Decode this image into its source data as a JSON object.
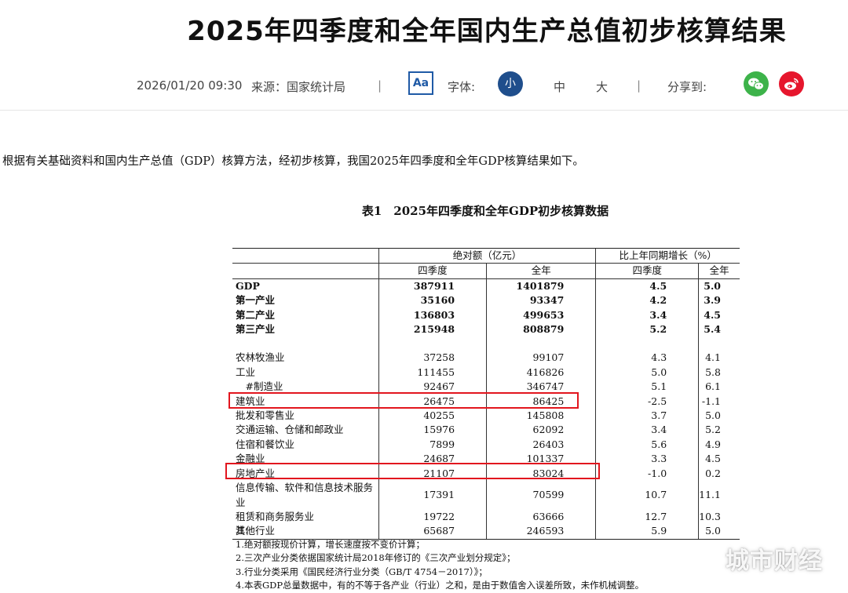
{
  "article": {
    "title": "2025年四季度和全年国内生产总值初步核算结果",
    "datetime": "2026/01/20 09:30",
    "source": "来源：国家统计局",
    "separator": "|",
    "font_button": "Aa",
    "font_label": "字体:",
    "size_small": "小",
    "size_medium": "中",
    "size_large": "大",
    "share_label": "分享到:",
    "intro": "根据有关基础资料和国内生产总值（GDP）核算方法，经初步核算，我国2025年四季度和全年GDP核算结果如下。"
  },
  "share_icons": [
    {
      "name": "wechat-icon",
      "color": "#3db34a"
    },
    {
      "name": "weibo-icon",
      "color": "#e6162d"
    }
  ],
  "table": {
    "title": "表1　2025年四季度和全年GDP初步核算数据",
    "group_absolute": "绝对额（亿元）",
    "group_growth": "比上年同期增长（%）",
    "sub_headers": [
      "四季度",
      "全年",
      "四季度",
      "全年"
    ],
    "rows": [
      {
        "name": "GDP",
        "q4": "387911",
        "year": "1401879",
        "g_q4": "4.5",
        "g_year": "5.0",
        "bold": true
      },
      {
        "name": "第一产业",
        "q4": "35160",
        "year": "93347",
        "g_q4": "4.2",
        "g_year": "3.9",
        "bold": true
      },
      {
        "name": "第二产业",
        "q4": "136803",
        "year": "499653",
        "g_q4": "3.4",
        "g_year": "4.5",
        "bold": true
      },
      {
        "name": "第三产业",
        "q4": "215948",
        "year": "808879",
        "g_q4": "5.2",
        "g_year": "5.4",
        "bold": true
      },
      {
        "name": "",
        "q4": "",
        "year": "",
        "g_q4": "",
        "g_year": "",
        "blank": true
      },
      {
        "name": "农林牧渔业",
        "q4": "37258",
        "year": "99107",
        "g_q4": "4.3",
        "g_year": "4.1"
      },
      {
        "name": "工业",
        "q4": "111455",
        "year": "416826",
        "g_q4": "5.0",
        "g_year": "5.8"
      },
      {
        "name": "　#制造业",
        "q4": "92467",
        "year": "346747",
        "g_q4": "5.1",
        "g_year": "6.1"
      },
      {
        "name": "建筑业",
        "q4": "26475",
        "year": "86425",
        "g_q4": "-2.5",
        "g_year": "-1.1"
      },
      {
        "name": "批发和零售业",
        "q4": "40255",
        "year": "145808",
        "g_q4": "3.7",
        "g_year": "5.0"
      },
      {
        "name": "交通运输、仓储和邮政业",
        "q4": "15976",
        "year": "62092",
        "g_q4": "3.4",
        "g_year": "5.2"
      },
      {
        "name": "住宿和餐饮业",
        "q4": "7899",
        "year": "26403",
        "g_q4": "5.6",
        "g_year": "4.9"
      },
      {
        "name": "金融业",
        "q4": "24687",
        "year": "101337",
        "g_q4": "3.3",
        "g_year": "4.5"
      },
      {
        "name": "房地产业",
        "q4": "21107",
        "year": "83024",
        "g_q4": "-1.0",
        "g_year": "0.2"
      },
      {
        "name": "信息传输、软件和信息技术服务业",
        "q4": "17391",
        "year": "70599",
        "g_q4": "10.7",
        "g_year": "11.1"
      },
      {
        "name": "租赁和商务服务业",
        "q4": "19722",
        "year": "63666",
        "g_q4": "12.7",
        "g_year": "10.3"
      },
      {
        "name": "其他行业",
        "q4": "65687",
        "year": "246593",
        "g_q4": "5.9",
        "g_year": "5.0"
      }
    ],
    "notes": [
      "注：",
      "1.绝对额按现价计算，增长速度按不变价计算；",
      "2.三次产业分类依据国家统计局2018年修订的《三次产业划分规定》；",
      "3.行业分类采用《国民经济行业分类（GB/T 4754－2017）》；",
      "4.本表GDP总量数据中，有的不等于各产业（行业）之和，是由于数值舍入误差所致，未作机械调整。"
    ]
  },
  "highlight_color": "#e2161e",
  "watermark": "城市财经"
}
